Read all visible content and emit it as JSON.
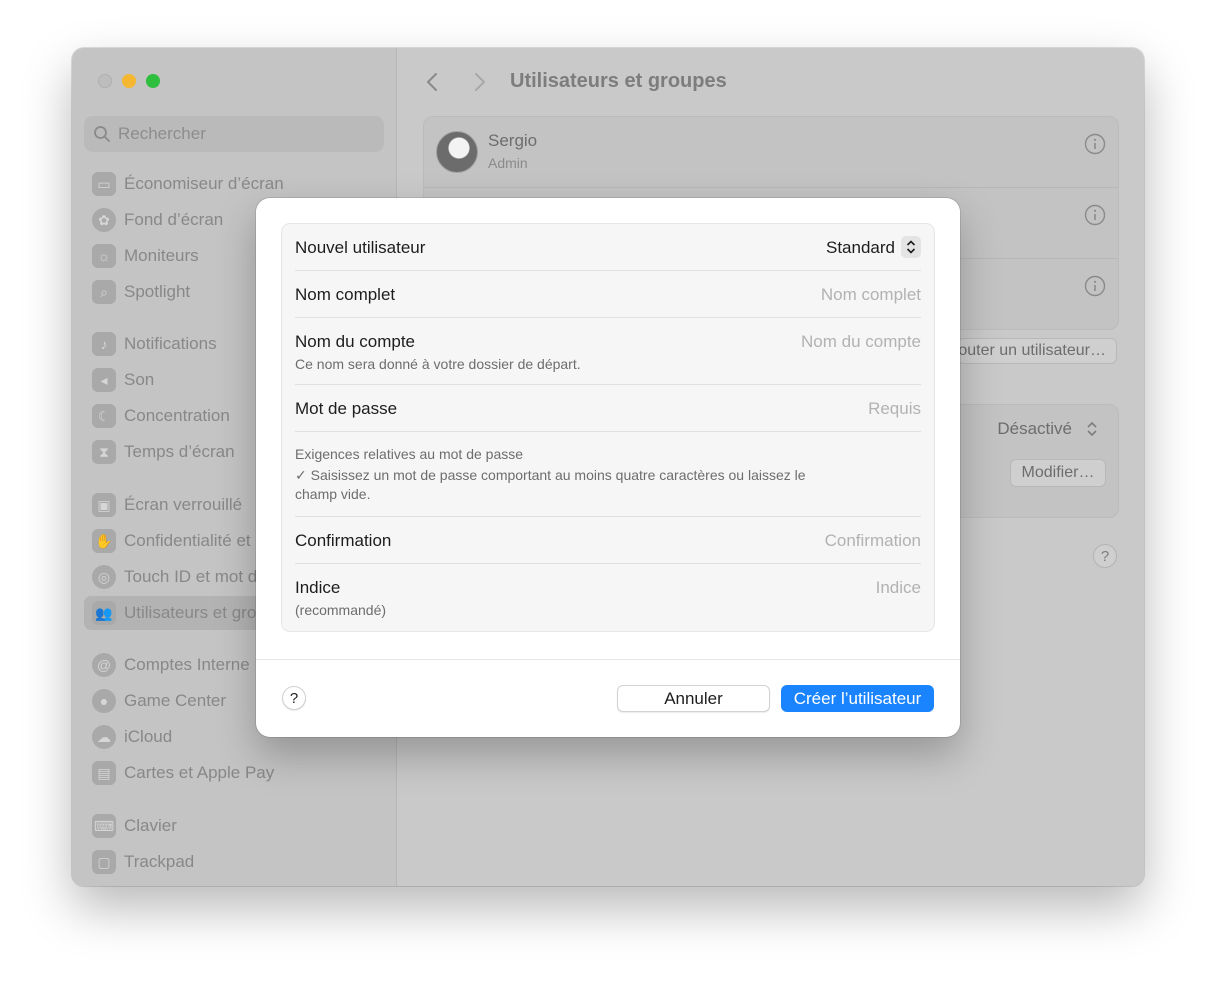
{
  "colors": {
    "accent": "#1a84ff",
    "traffic_min": "#f5b731",
    "traffic_max": "#2fbf3f"
  },
  "search": {
    "placeholder": "Rechercher"
  },
  "sidebar": {
    "items": [
      {
        "label": "Économiseur d’écran",
        "icon": "screensaver-icon"
      },
      {
        "label": "Fond d’écran",
        "icon": "wallpaper-icon"
      },
      {
        "label": "Moniteurs",
        "icon": "displays-icon"
      },
      {
        "label": "Spotlight",
        "icon": "spotlight-icon"
      },
      {
        "label": "Notifications",
        "icon": "notifications-icon"
      },
      {
        "label": "Son",
        "icon": "sound-icon"
      },
      {
        "label": "Concentration",
        "icon": "focus-icon"
      },
      {
        "label": "Temps d’écran",
        "icon": "screen-time-icon"
      },
      {
        "label": "Écran verrouillé",
        "icon": "lock-screen-icon"
      },
      {
        "label": "Confidentialité et",
        "icon": "privacy-icon"
      },
      {
        "label": "Touch ID et mot d",
        "icon": "touch-id-icon"
      },
      {
        "label": "Utilisateurs et gro",
        "icon": "users-icon"
      },
      {
        "label": "Comptes Interne",
        "icon": "internet-accounts-icon"
      },
      {
        "label": "Game Center",
        "icon": "game-center-icon"
      },
      {
        "label": "iCloud",
        "icon": "icloud-icon"
      },
      {
        "label": "Cartes et Apple Pay",
        "icon": "wallet-icon"
      },
      {
        "label": "Clavier",
        "icon": "keyboard-icon"
      },
      {
        "label": "Trackpad",
        "icon": "trackpad-icon"
      }
    ]
  },
  "main": {
    "title": "Utilisateurs et groupes",
    "user": {
      "name": "Sergio",
      "role": "Admin"
    },
    "add_user_label": "Ajouter un utilisateur…",
    "auto_login_value": "Désactivé",
    "modify_label": "Modifier…",
    "help_label": "?"
  },
  "dialog": {
    "new_user_label": "Nouvel utilisateur",
    "account_type": "Standard",
    "full_name": {
      "label": "Nom complet",
      "placeholder": "Nom complet"
    },
    "account_name": {
      "label": "Nom du compte",
      "placeholder": "Nom du compte",
      "note": "Ce nom sera donné à votre dossier de départ."
    },
    "password": {
      "label": "Mot de passe",
      "placeholder": "Requis"
    },
    "requirements": {
      "title": "Exigences relatives au mot de passe",
      "line1": "✓ Saisissez un mot de passe comportant au moins quatre caractères ou laissez le",
      "line2": "champ vide."
    },
    "confirmation": {
      "label": "Confirmation",
      "placeholder": "Confirmation"
    },
    "hint": {
      "label": "Indice",
      "note": "(recommandé)",
      "placeholder": "Indice"
    },
    "help_label": "?",
    "cancel_label": "Annuler",
    "create_label": "Créer l’utilisateur"
  }
}
